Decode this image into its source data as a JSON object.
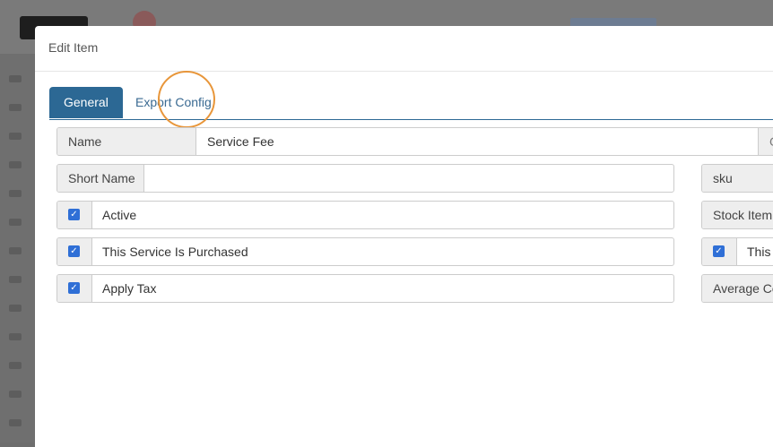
{
  "modal": {
    "title": "Edit Item",
    "tabs": [
      {
        "label": "General",
        "active": true
      },
      {
        "label": "Export Config",
        "active": false
      }
    ]
  },
  "form": {
    "name": {
      "label": "Name",
      "value": "Service Fee"
    },
    "short_name": {
      "label": "Short Name",
      "value": ""
    },
    "active": {
      "label": "Active",
      "checked": true
    },
    "service_purchased": {
      "label": "This Service Is Purchased",
      "checked": true
    },
    "apply_tax": {
      "label": "Apply Tax",
      "checked": true
    },
    "sku": {
      "label": "sku"
    },
    "stock_item": {
      "label": "Stock Item"
    },
    "right_checkbox": {
      "label": "This S",
      "checked": true
    },
    "average_cost": {
      "label": "Average Co"
    }
  },
  "icons": {
    "check": "✓",
    "name_suffix_icon": "G"
  },
  "colors": {
    "primary": "#2c6894",
    "checkbox": "#2f6fd6",
    "highlight_ring": "#e8963a"
  }
}
